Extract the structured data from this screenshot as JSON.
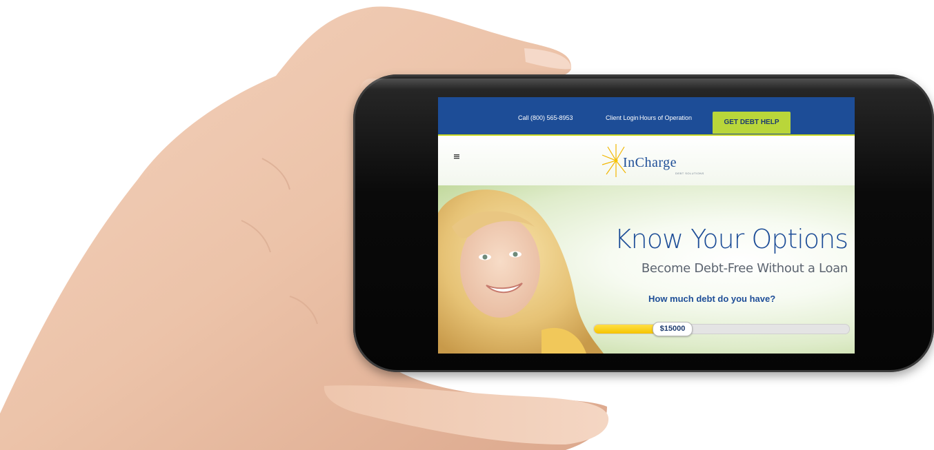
{
  "topbar": {
    "phone_label": "Call (800) 565-8953",
    "client_login_label": "Client Login",
    "hours_label": "Hours of Operation",
    "cta_label": "GET DEBT HELP"
  },
  "header": {
    "logo_text": "InCharge",
    "logo_subtext": "DEBT SOLUTIONS",
    "menu_icon": "hamburger-menu-icon",
    "logo_icon": "sunburst-logo-icon"
  },
  "hero": {
    "title": "Know Your Options",
    "subtitle": "Become Debt-Free Without a Loan",
    "question": "How much debt do you have?"
  },
  "debt_slider": {
    "value_label": "$15000",
    "fill_fraction": 0.25
  },
  "colors": {
    "brand_blue": "#1d4d97",
    "cta_green": "#b9d63a",
    "slider_yellow": "#f5c400"
  }
}
